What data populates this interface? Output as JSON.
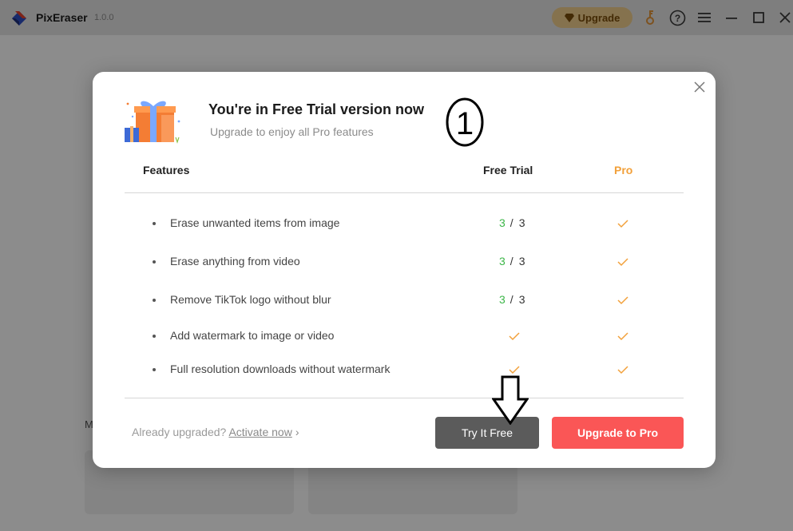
{
  "app": {
    "name": "PixEraser",
    "version": "1.0.0",
    "upgrade_label": "Upgrade"
  },
  "background": {
    "partial_text": "M"
  },
  "modal": {
    "title": "You're in Free Trial version now",
    "subtitle": "Upgrade to enjoy all Pro features",
    "annotation_number": "1",
    "headers": {
      "features": "Features",
      "free_trial": "Free Trial",
      "pro": "Pro"
    },
    "features": [
      {
        "label": "Erase unwanted items from image",
        "free_used": "3",
        "free_total": "3",
        "free_check": false,
        "pro_check": true
      },
      {
        "label": "Erase anything from video",
        "free_used": "3",
        "free_total": "3",
        "free_check": false,
        "pro_check": true
      },
      {
        "label": "Remove TikTok logo without blur",
        "free_used": "3",
        "free_total": "3",
        "free_check": false,
        "pro_check": true
      },
      {
        "label": "Add watermark to image or video",
        "free_check": true,
        "pro_check": true
      },
      {
        "label": "Full resolution downloads without watermark",
        "free_check": true,
        "pro_check": true
      }
    ],
    "footer": {
      "already_text": "Already upgraded?",
      "activate_label": "Activate now",
      "activate_arrow": "›",
      "try_label": "Try It Free",
      "upgrade_pro_label": "Upgrade to Pro"
    }
  },
  "colors": {
    "count_green": "#3cb648",
    "check_orange": "#f2a03a",
    "pro_button": "#fa5656",
    "try_button": "#5b5b5b",
    "upgrade_pill": "#f2cf8e"
  },
  "icons": {
    "logo": "pixeraser-logo-icon",
    "gift": "gift-box-icon",
    "key": "key-icon",
    "help": "help-icon",
    "menu": "menu-icon",
    "minimize": "minimize-icon",
    "maximize": "maximize-icon",
    "close": "close-icon",
    "check": "check-icon",
    "diamond": "diamond-icon"
  }
}
